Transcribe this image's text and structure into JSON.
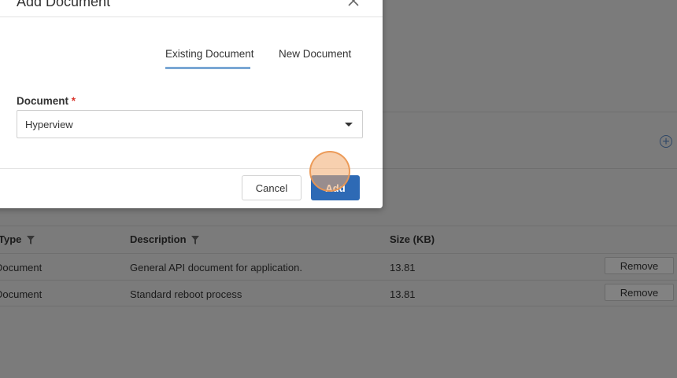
{
  "modal": {
    "title": "Add Document",
    "close_icon": "close-icon",
    "tabs": [
      {
        "label": "Existing Document",
        "active": true
      },
      {
        "label": "New Document",
        "active": false
      }
    ],
    "document_field": {
      "label": "Document",
      "required_mark": "*",
      "selected_value": "Hyperview"
    },
    "footer": {
      "cancel_label": "Cancel",
      "add_label": "Add"
    }
  },
  "table": {
    "headers": [
      "Type",
      "Description",
      "Size (KB)"
    ],
    "rows": [
      {
        "type": "Document",
        "description": "General API document for application.",
        "size": "13.81",
        "action": "Remove"
      },
      {
        "type": "Document",
        "description": "Standard reboot process",
        "size": "13.81",
        "action": "Remove"
      }
    ]
  },
  "colors": {
    "accent": "#2e6ab5",
    "tab_underline": "#7aa7d4",
    "required": "#d9342b"
  }
}
